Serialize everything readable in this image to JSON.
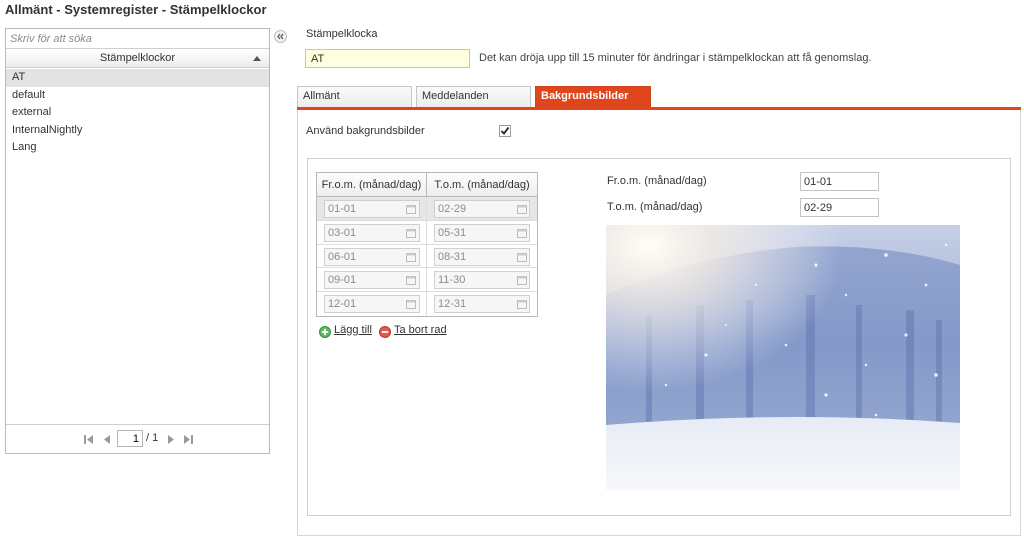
{
  "page": {
    "title": "Allmänt - Systemregister - Stämpelklockor"
  },
  "sidebar": {
    "search_placeholder": "Skriv för att söka",
    "header": "Stämpelklockor",
    "items": [
      {
        "label": "AT",
        "selected": true
      },
      {
        "label": "default"
      },
      {
        "label": "external"
      },
      {
        "label": "InternalNightly"
      },
      {
        "label": "Lang"
      }
    ],
    "pager": {
      "current": "1",
      "total_text": "/ 1"
    }
  },
  "form": {
    "clock_label": "Stämpelklocka",
    "clock_value": "AT",
    "notice": "Det kan dröja upp till 15 minuter för ändringar i stämpelklockan att få genomslag."
  },
  "tabs": [
    {
      "label": "Allmänt"
    },
    {
      "label": "Meddelanden"
    },
    {
      "label": "Bakgrundsbilder",
      "active": true
    }
  ],
  "backgrounds": {
    "use_label": "Använd bakgrundsbilder",
    "use_checked": true,
    "table": {
      "headers": [
        "Fr.o.m. (månad/dag)",
        "T.o.m. (månad/dag)"
      ],
      "rows": [
        {
          "from": "01-01",
          "to": "02-29"
        },
        {
          "from": "03-01",
          "to": "05-31"
        },
        {
          "from": "06-01",
          "to": "08-31"
        },
        {
          "from": "09-01",
          "to": "11-30"
        },
        {
          "from": "12-01",
          "to": "12-31"
        }
      ]
    },
    "add_label": "Lägg till",
    "remove_label": "Ta bort rad",
    "detail": {
      "from_label": "Fr.o.m. (månad/dag)",
      "from_value": "01-01",
      "to_label": "T.o.m. (månad/dag)",
      "to_value": "02-29"
    }
  },
  "colors": {
    "accent": "#e0461e",
    "selected_row": "#e3e3e3",
    "input_highlight": "#ffffe0"
  }
}
